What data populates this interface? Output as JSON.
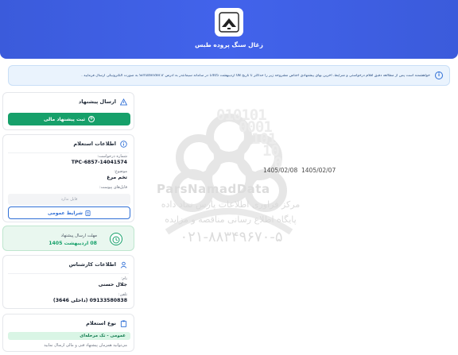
{
  "header": {
    "title": "زغال سنگ پروده طبس",
    "logo_icon": "org-logo"
  },
  "notice": {
    "text": "خواهشمند است پس از مطالعه دقیق اقلام درخواستی و شرایط، آخرین بهای پیشنهادی اجناس مشروحه زیر را حداکثر تا تاریخ 08 اردیبهشت 1405 در سامانه سیمانتدر به آدرس Simatender.ir به صورت الکترونیکی ارسال فرمایید .",
    "icon": "info-icon"
  },
  "watermark": {
    "digits": [
      "010101",
      "0001",
      "101",
      "10",
      "0"
    ],
    "brand": "ParsNamadData",
    "line1": "مرکز فراوری اطلاعات پارس نماد داده",
    "line2": "پایگاه اطلاع رسانی مناقصه و مزایده",
    "phone": "۰۲۱-۸۸۳۴۹۶۷۰-۵"
  },
  "dates": {
    "date_a": "1405/02/07",
    "date_b": "1405/02/08"
  },
  "send_offer": {
    "title": "ارسال پیشنهاد",
    "icon": "warning-icon",
    "button_label": "ثبت پیشنهاد مالی",
    "button_icon": "plus-circle-icon"
  },
  "inquiry_info": {
    "title": "اطلاعات استعلام",
    "icon": "info-icon",
    "request_number_label": "شماره درخواست:",
    "request_number": "TPC-6857-14041574",
    "subject_label": "موضوع:",
    "subject": "تخم مرغ",
    "attachments_label": "فایل‌های پیوست:",
    "attachments_value": "فایل ندارد",
    "terms_button": "شرایط عمومی",
    "terms_icon": "document-icon"
  },
  "deadline": {
    "label": "مهلت ارسال پیشنهاد",
    "value": "08 اردیبهشت 1405",
    "icon": "clock-icon"
  },
  "expert_info": {
    "title": "اطلاعات کارشناس",
    "icon": "user-icon",
    "name_label": "نام:",
    "name": "جلال حسنی",
    "phone_label": "تلفن:",
    "phone": "09133580838 (داخلی 3646)"
  },
  "inquiry_type": {
    "title": "نوع استعلام",
    "icon": "clipboard-icon",
    "badge": "عمومی - تک مرحله‌ای",
    "description": "می‌توانید همزمان پیشنهاد فنی و مالی ارسال نمایید"
  },
  "colors": {
    "header_blue": "#4263eb",
    "accent_green": "#16a06a",
    "link_blue": "#2f6fd6"
  }
}
